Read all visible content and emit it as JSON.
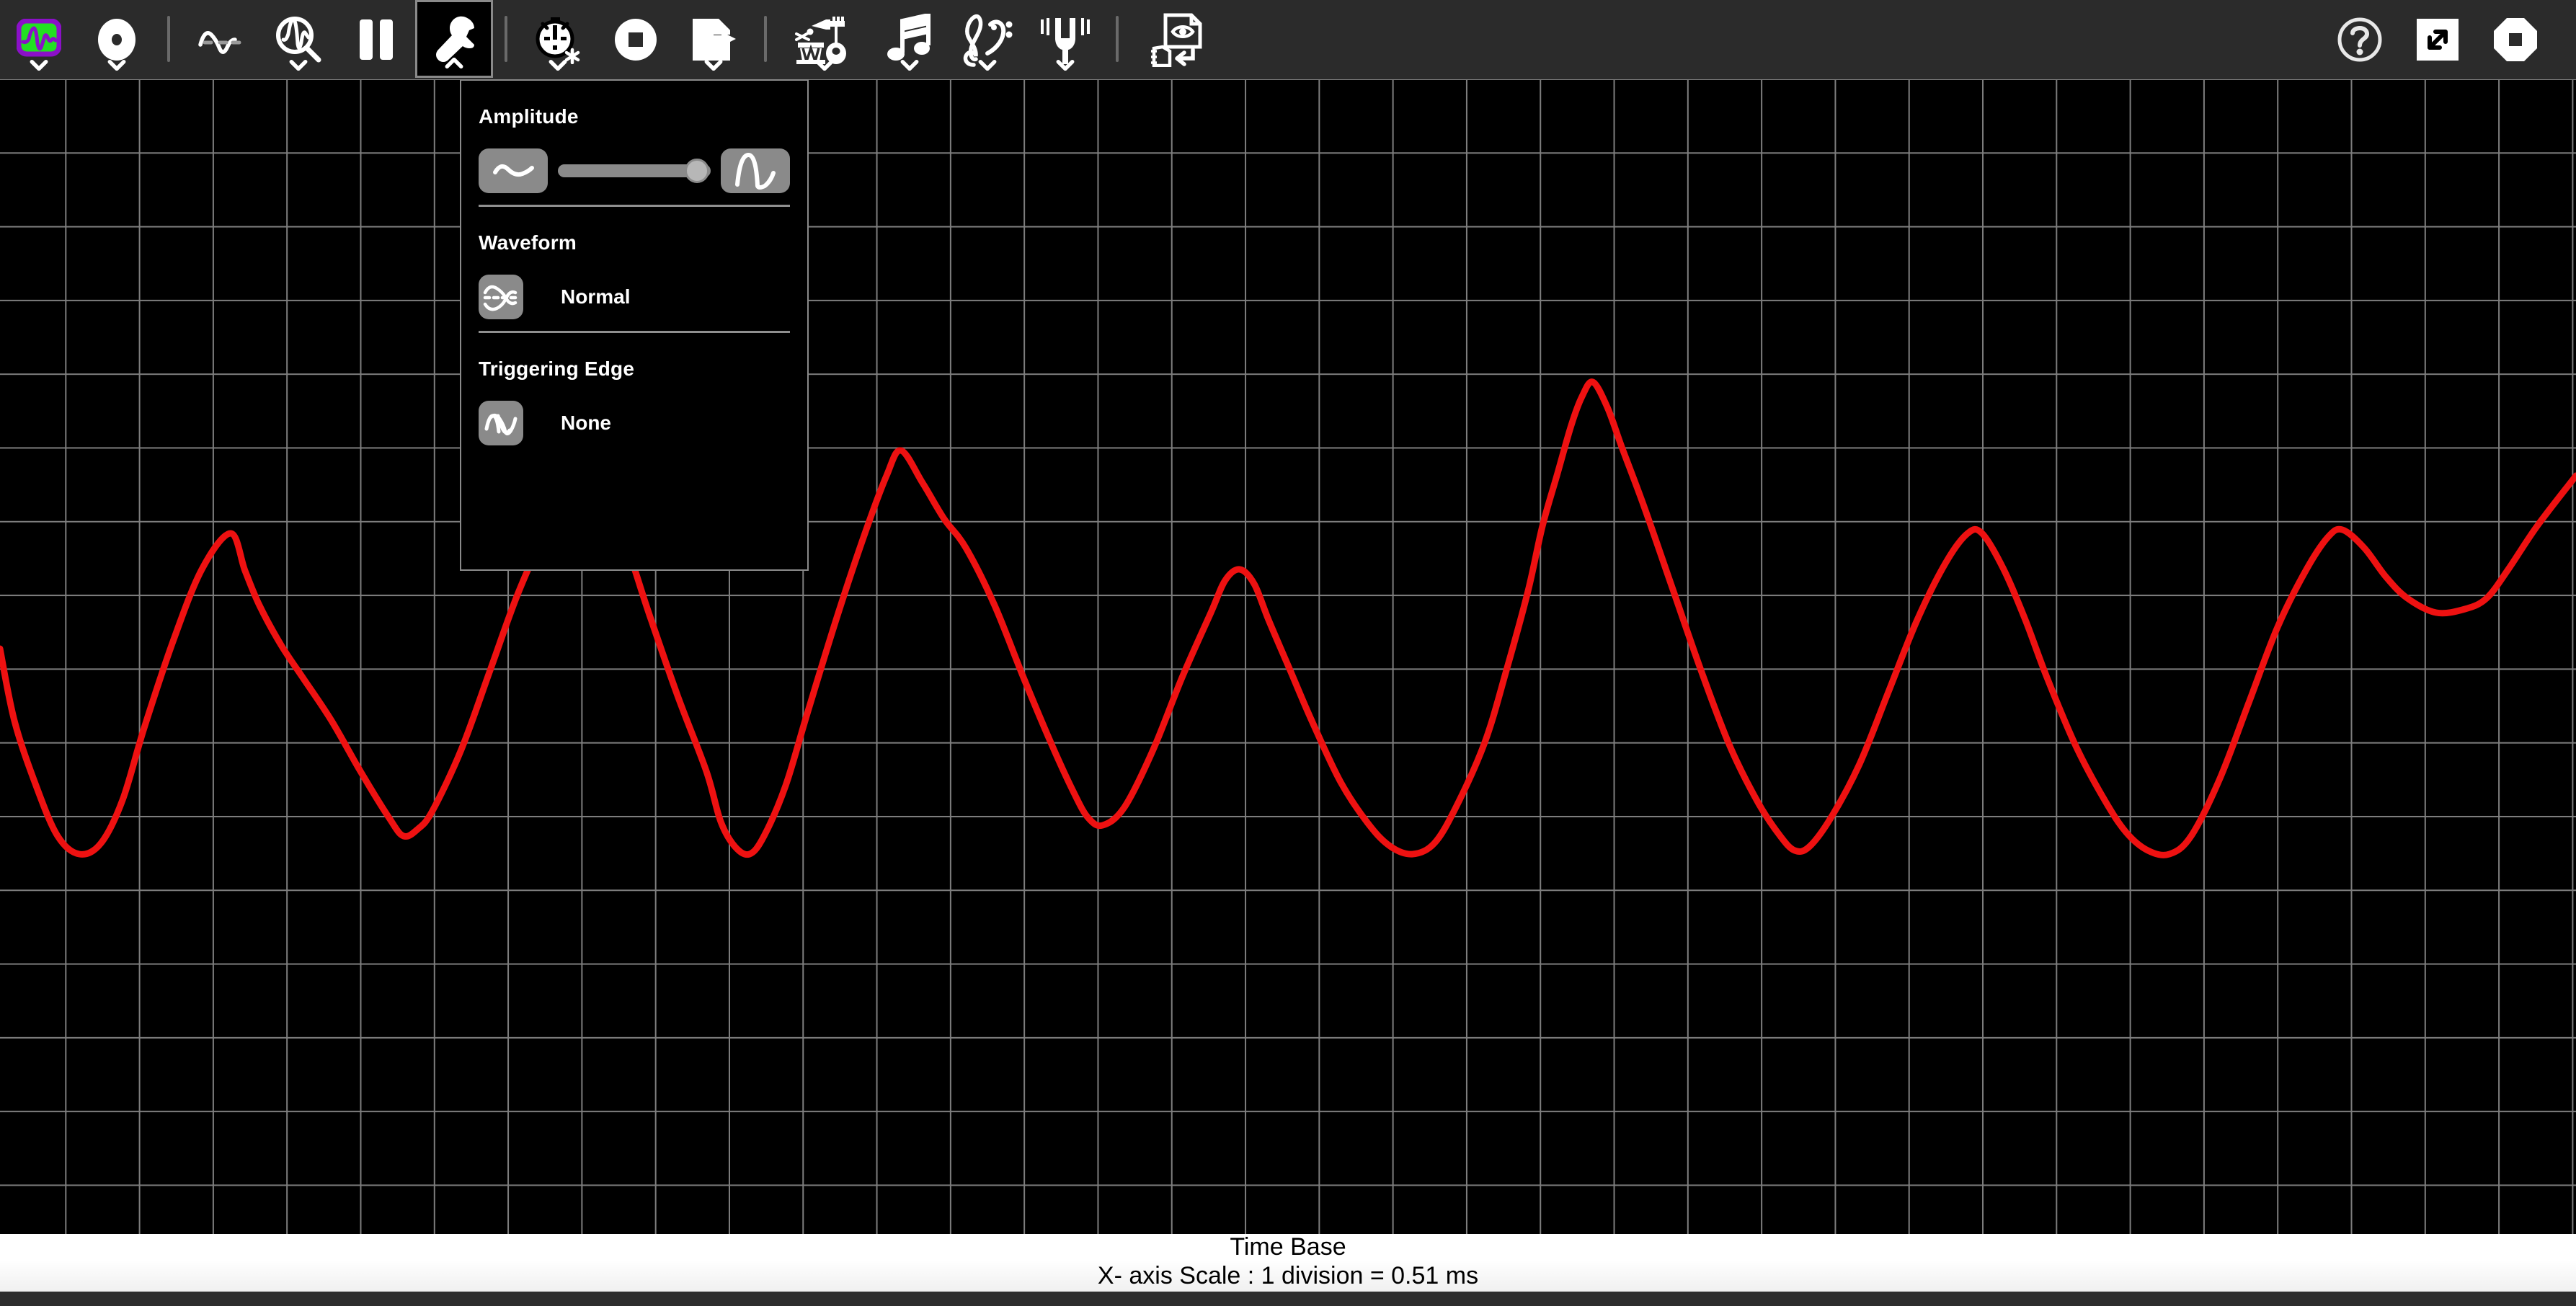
{
  "app": {
    "title": "Oscilloscope"
  },
  "toolbar": {
    "left_items": [
      {
        "name": "app-logo-icon",
        "label": "Oscilloscope",
        "caret": true,
        "active": false
      },
      {
        "name": "record-icon",
        "label": "Record",
        "caret": true,
        "active": false
      },
      {
        "name": "divider-1",
        "label": "",
        "caret": false,
        "active": false
      },
      {
        "name": "waveform-icon",
        "label": "Waveform",
        "caret": false,
        "active": false
      },
      {
        "name": "waveform-zoom-icon",
        "label": "Zoom Waveform",
        "caret": true,
        "active": false
      },
      {
        "name": "pause-icon",
        "label": "Pause",
        "caret": false,
        "active": false
      },
      {
        "name": "wrench-icon",
        "label": "Settings",
        "caret": true,
        "active": true
      },
      {
        "name": "divider-2",
        "label": "",
        "caret": false,
        "active": false
      },
      {
        "name": "stopwatch-icon",
        "label": "Timer",
        "caret": true,
        "active": false
      },
      {
        "name": "stop-record-icon",
        "label": "Stop",
        "caret": false,
        "active": false
      },
      {
        "name": "export-file-icon",
        "label": "Export",
        "caret": true,
        "active": false
      },
      {
        "name": "divider-3",
        "label": "",
        "caret": false,
        "active": false
      },
      {
        "name": "instruments-icon",
        "label": "Instruments",
        "caret": true,
        "active": false
      },
      {
        "name": "music-note-icon",
        "label": "Notes",
        "caret": true,
        "active": false
      },
      {
        "name": "clef-icon",
        "label": "Clefs",
        "caret": true,
        "active": false
      },
      {
        "name": "tuning-fork-icon",
        "label": "Tuner",
        "caret": true,
        "active": false
      },
      {
        "name": "divider-4",
        "label": "",
        "caret": false,
        "active": false
      },
      {
        "name": "preview-page-icon",
        "label": "Preview",
        "caret": false,
        "active": false
      }
    ],
    "right_items": [
      {
        "name": "help-icon",
        "label": "Help"
      },
      {
        "name": "fullscreen-icon",
        "label": "Full Screen"
      },
      {
        "name": "stop-octagon-icon",
        "label": "Stop"
      }
    ]
  },
  "settings_panel": {
    "amplitude": {
      "title": "Amplitude",
      "min_icon": "small-wave-icon",
      "max_icon": "large-wave-icon",
      "slider_value": 100,
      "slider_min": 0,
      "slider_max": 100
    },
    "waveform": {
      "title": "Waveform",
      "icon": "waveform-normal-icon",
      "value": "Normal"
    },
    "triggering_edge": {
      "title": "Triggering Edge",
      "icon": "trigger-edge-icon",
      "value": "None"
    }
  },
  "footer": {
    "title": "Time Base",
    "scale": "X- axis Scale : 1 division = 0.51 ms"
  },
  "colors": {
    "trace": "#ee1111",
    "grid": "#9a9a9a",
    "toolbar_bg": "#2b2b2b",
    "scope_bg": "#000000",
    "accent_green": "#22e022",
    "accent_purple": "#8b10c8"
  },
  "chart_data": {
    "type": "line",
    "title": "Time Base",
    "xlabel": "X- axis Scale : 1 division = 0.51 ms",
    "ylabel": "",
    "grid": true,
    "legend": "none",
    "series": [
      {
        "name": "audio-waveform",
        "color": "#ee1111",
        "points": [
          [
            0,
            900
          ],
          [
            20,
            1000
          ],
          [
            50,
            1090
          ],
          [
            80,
            1160
          ],
          [
            110,
            1185
          ],
          [
            140,
            1170
          ],
          [
            170,
            1110
          ],
          [
            200,
            1010
          ],
          [
            240,
            890
          ],
          [
            280,
            790
          ],
          [
            320,
            740
          ],
          [
            340,
            792
          ],
          [
            360,
            840
          ],
          [
            390,
            895
          ],
          [
            420,
            940
          ],
          [
            460,
            1000
          ],
          [
            500,
            1070
          ],
          [
            540,
            1135
          ],
          [
            560,
            1160
          ],
          [
            580,
            1150
          ],
          [
            600,
            1125
          ],
          [
            640,
            1040
          ],
          [
            680,
            930
          ],
          [
            720,
            820
          ],
          [
            760,
            735
          ],
          [
            800,
            690
          ],
          [
            840,
            700
          ],
          [
            870,
            760
          ],
          [
            900,
            850
          ],
          [
            940,
            965
          ],
          [
            980,
            1070
          ],
          [
            1000,
            1140
          ],
          [
            1020,
            1175
          ],
          [
            1040,
            1185
          ],
          [
            1060,
            1160
          ],
          [
            1090,
            1090
          ],
          [
            1120,
            990
          ],
          [
            1160,
            860
          ],
          [
            1200,
            740
          ],
          [
            1230,
            660
          ],
          [
            1250,
            625
          ],
          [
            1280,
            670
          ],
          [
            1310,
            720
          ],
          [
            1340,
            760
          ],
          [
            1380,
            840
          ],
          [
            1420,
            940
          ],
          [
            1460,
            1035
          ],
          [
            1490,
            1100
          ],
          [
            1510,
            1135
          ],
          [
            1530,
            1145
          ],
          [
            1560,
            1120
          ],
          [
            1600,
            1040
          ],
          [
            1640,
            940
          ],
          [
            1680,
            850
          ],
          [
            1700,
            805
          ],
          [
            1720,
            790
          ],
          [
            1740,
            810
          ],
          [
            1760,
            860
          ],
          [
            1790,
            930
          ],
          [
            1820,
            1000
          ],
          [
            1860,
            1085
          ],
          [
            1900,
            1145
          ],
          [
            1930,
            1175
          ],
          [
            1960,
            1185
          ],
          [
            1990,
            1170
          ],
          [
            2020,
            1120
          ],
          [
            2060,
            1030
          ],
          [
            2090,
            930
          ],
          [
            2120,
            820
          ],
          [
            2140,
            730
          ],
          [
            2160,
            660
          ],
          [
            2180,
            590
          ],
          [
            2195,
            550
          ],
          [
            2210,
            530
          ],
          [
            2230,
            565
          ],
          [
            2250,
            620
          ],
          [
            2280,
            700
          ],
          [
            2320,
            815
          ],
          [
            2360,
            930
          ],
          [
            2400,
            1035
          ],
          [
            2440,
            1115
          ],
          [
            2470,
            1160
          ],
          [
            2490,
            1180
          ],
          [
            2510,
            1175
          ],
          [
            2540,
            1135
          ],
          [
            2580,
            1060
          ],
          [
            2620,
            960
          ],
          [
            2660,
            860
          ],
          [
            2700,
            780
          ],
          [
            2730,
            740
          ],
          [
            2750,
            740
          ],
          [
            2780,
            790
          ],
          [
            2810,
            860
          ],
          [
            2840,
            940
          ],
          [
            2880,
            1035
          ],
          [
            2920,
            1110
          ],
          [
            2950,
            1155
          ],
          [
            2980,
            1180
          ],
          [
            3010,
            1185
          ],
          [
            3040,
            1160
          ],
          [
            3080,
            1080
          ],
          [
            3120,
            975
          ],
          [
            3160,
            870
          ],
          [
            3200,
            790
          ],
          [
            3230,
            745
          ],
          [
            3250,
            735
          ],
          [
            3280,
            760
          ],
          [
            3310,
            800
          ],
          [
            3340,
            830
          ],
          [
            3380,
            850
          ],
          [
            3420,
            845
          ],
          [
            3450,
            830
          ],
          [
            3480,
            790
          ],
          [
            3520,
            730
          ],
          [
            3574,
            660
          ]
        ]
      }
    ],
    "xlim": [
      0,
      3574
    ],
    "ylim": [
      110,
      1712
    ],
    "grid_division_ms": 0.51
  }
}
